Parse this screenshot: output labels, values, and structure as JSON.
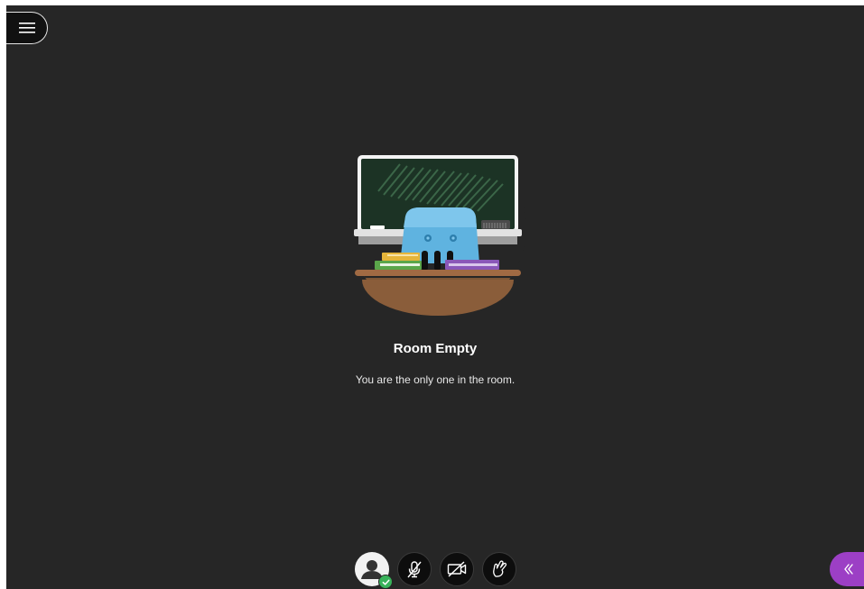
{
  "main": {
    "title": "Room Empty",
    "subtitle": "You are the only one in the room."
  },
  "icons": {
    "menu": "hamburger-menu-icon",
    "avatar": "user-avatar-icon",
    "status": "checkmark-icon",
    "microphone": "microphone-muted-icon",
    "camera": "camera-off-icon",
    "hand": "raise-hand-icon",
    "collaborate_panel": "double-chevron-left-icon"
  },
  "colors": {
    "stage_background": "#262626",
    "accent_purple": "#9c3fc5",
    "status_green": "#38b25a"
  }
}
